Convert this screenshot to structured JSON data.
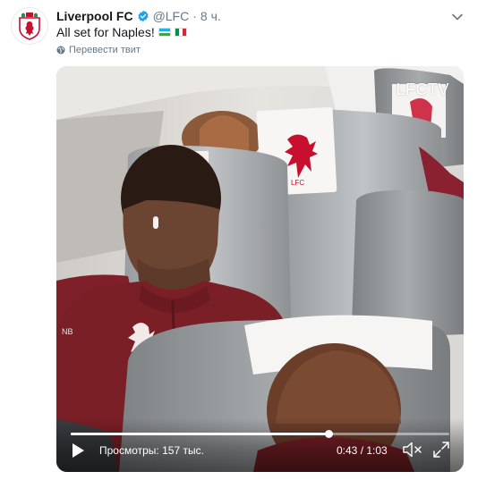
{
  "tweet": {
    "display_name": "Liverpool FC",
    "handle": "@LFC",
    "separator": "·",
    "time": "8 ч.",
    "text": "All set for Naples!",
    "translate_label": "Перевести твит",
    "icons": {
      "avatar": "lfc-crest-icon",
      "verified": "verified-badge-icon",
      "caret": "chevron-down-icon",
      "globe": "globe-icon",
      "flags": [
        "uzbekistan-flag-icon",
        "italy-flag-icon"
      ]
    }
  },
  "video": {
    "watermark": "LFCTV",
    "views_label": "Просмотры: 157 тыс.",
    "time_display": "0:43 / 1:03",
    "progress": 0.682,
    "icons": {
      "play": "play-icon",
      "volume": "volume-muted-icon",
      "fullscreen": "fullscreen-icon"
    }
  },
  "colors": {
    "accent": "#1da1f2",
    "secondary_text": "#657786",
    "lfc_red": "#c8102e",
    "maroon_jacket": "#7a1f26"
  }
}
